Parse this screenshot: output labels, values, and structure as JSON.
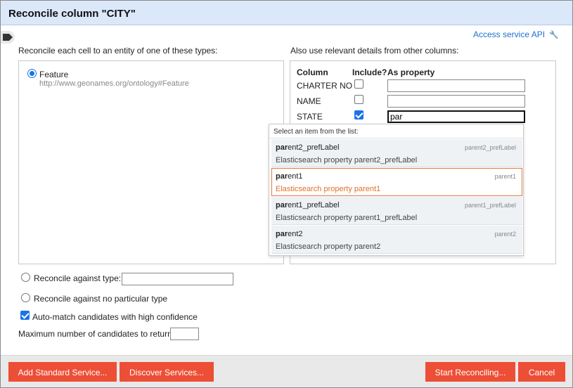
{
  "dialog": {
    "title": "Reconcile column \"CITY\"",
    "access_service_api": "Access service API"
  },
  "types_panel": {
    "heading": "Reconcile each cell to an entity of one of these types:",
    "types": [
      {
        "name": "Feature",
        "uri": "http://www.geonames.org/ontology#Feature",
        "selected": true
      }
    ]
  },
  "columns_panel": {
    "heading": "Also use relevant details from other columns:",
    "header_column": "Column",
    "header_include": "Include?",
    "header_property": "As property",
    "rows": [
      {
        "column": "CHARTER NO",
        "include": false,
        "property": ""
      },
      {
        "column": "NAME",
        "include": false,
        "property": ""
      },
      {
        "column": "STATE",
        "include": true,
        "property": "par"
      }
    ]
  },
  "suggest": {
    "header": "Select an item from the list:",
    "query": "par",
    "items": [
      {
        "name_match": "par",
        "name_rest": "ent2_prefLabel",
        "id": "parent2_prefLabel",
        "description": "Elasticsearch property parent2_prefLabel",
        "active": false
      },
      {
        "name_match": "par",
        "name_rest": "ent1",
        "id": "parent1",
        "description": "Elasticsearch property parent1",
        "active": true
      },
      {
        "name_match": "par",
        "name_rest": "ent1_prefLabel",
        "id": "parent1_prefLabel",
        "description": "Elasticsearch property parent1_prefLabel",
        "active": false
      },
      {
        "name_match": "par",
        "name_rest": "ent2",
        "id": "parent2",
        "description": "Elasticsearch property parent2",
        "active": false
      }
    ]
  },
  "options": {
    "against_type_label": "Reconcile against type:",
    "against_type_value": "",
    "no_type_label": "Reconcile against no particular type",
    "auto_match_label": "Auto-match candidates with high confidence",
    "auto_match_checked": true,
    "max_candidates_label": "Maximum number of candidates to return",
    "max_candidates_value": ""
  },
  "footer": {
    "add_standard_service": "Add Standard Service...",
    "discover_services": "Discover Services...",
    "start_reconciling": "Start Reconciling...",
    "cancel": "Cancel"
  },
  "colors": {
    "header_bg": "#dbe8fa",
    "link": "#1f6fd1",
    "button": "#ec4f36",
    "active_item_border": "#e07b39",
    "checkbox_accent": "#1a73e8"
  },
  "icons": {
    "tag": "tag-icon",
    "wrench": "wrench-icon"
  }
}
